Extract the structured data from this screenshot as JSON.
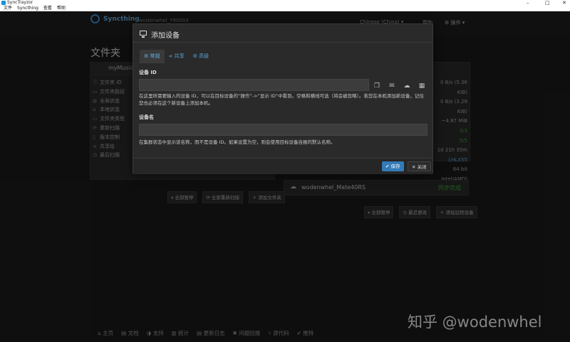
{
  "window": {
    "title": "SyncTrayzor",
    "min": "–",
    "max": "□",
    "close": "✕"
  },
  "menu": [
    "文件",
    "Syncthing",
    "查看",
    "帮助"
  ],
  "nav": {
    "brand": "Syncthing",
    "host": "wodenwhel_Y9000X",
    "language": "Chinese (China) ▾",
    "help": "帮助",
    "actions": "⚙ 操作 ▾"
  },
  "folders": {
    "title": "文件夹",
    "folder_name": "myMusic",
    "rows": [
      "文件夹 ID",
      "文件夹路径",
      "全局状态",
      "本地状态",
      "文件夹类型",
      "重新扫描",
      "版本控制",
      "共享给",
      "最后扫描"
    ],
    "buttons": [
      "⏸ 全部暂停",
      "⟳ 全部重新扫描",
      "＋ 添加文件夹"
    ]
  },
  "right_values": [
    "0 B/s (5.36 KiB)",
    "0 B/s (3.29 KiB)",
    "~4.87 MiB",
    "3/3",
    "5/5",
    "1d 21h 35m",
    "LHLX55",
    "64 bit Intel/AMD)"
  ],
  "device": {
    "name": "wodenwhel_Mate40RS",
    "status": "同步完成"
  },
  "device_buttons": [
    "⏸ 全部暂停",
    "◷ 最近更改",
    "＋ 添加远程设备"
  ],
  "footer": [
    "⌂ 主页",
    "▤ 文档",
    "◑ 支持",
    "▥ 统计",
    "▤ 更新日志",
    "✖ 问题回报",
    "⑂ 源代码",
    "✔ 推特"
  ],
  "watermark": "知乎 @wodenwhel",
  "modal": {
    "title": "添加设备",
    "tabs": [
      "⚙ 常规",
      "⋖ 共享",
      "⚙ 高级"
    ],
    "device_id_label": "设备 ID",
    "device_id_value": "",
    "device_id_help": "在这里所需要输入的设备 ID，可以在目标设备的“操作”->“显示 ID”中看到。空格和横线可选（将会被忽略）。若您在本机添加新设备，记住您也必须在这个新设备上添加本机。",
    "device_name_label": "设备名",
    "device_name_value": "",
    "device_name_help": "在集群状态中显示该名称，而不是设备 ID。如果设置为空，则会使用目标设备自报的默认名称。",
    "save": "✔ 保存",
    "close": "✕ 关闭"
  }
}
